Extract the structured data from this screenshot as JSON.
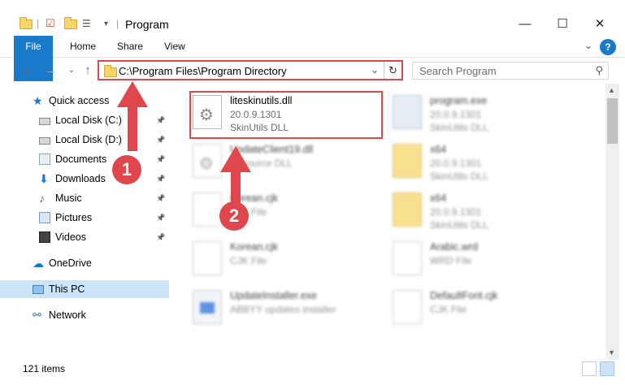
{
  "window": {
    "title": "Program",
    "minimize": "—",
    "maximize": "☐",
    "close": "✕"
  },
  "ribbon": {
    "tabs": [
      "File",
      "Home",
      "Share",
      "View"
    ],
    "help": "?"
  },
  "address": {
    "path": "C:\\Program Files\\Program Directory",
    "refresh": "↻",
    "dropdown": "⌄"
  },
  "search": {
    "placeholder": "Search Program"
  },
  "sidebar": {
    "items": [
      {
        "label": "Quick access",
        "icon": "star-icon"
      },
      {
        "label": "Local Disk (C:)",
        "icon": "drive-icon",
        "pinned": true
      },
      {
        "label": "Local Disk (D:)",
        "icon": "drive-icon",
        "pinned": true
      },
      {
        "label": "Documents",
        "icon": "documents-icon",
        "pinned": true
      },
      {
        "label": "Downloads",
        "icon": "downloads-icon",
        "pinned": true
      },
      {
        "label": "Music",
        "icon": "music-icon",
        "pinned": true
      },
      {
        "label": "Pictures",
        "icon": "pictures-icon",
        "pinned": true
      },
      {
        "label": "Videos",
        "icon": "videos-icon",
        "pinned": true
      },
      {
        "label": "OneDrive",
        "icon": "onedrive-icon"
      },
      {
        "label": "This PC",
        "icon": "this-pc-icon",
        "selected": true
      },
      {
        "label": "Network",
        "icon": "network-icon"
      }
    ]
  },
  "files": [
    {
      "name": "liteskinutils.dll",
      "meta1": "20.0.9.1301",
      "meta2": "SkinUtils DLL",
      "icon": "dll-gear-icon"
    },
    {
      "name": "program.exe",
      "meta1": "20.0.9.1301",
      "meta2": "SkinUtils DLL",
      "icon": "exe-icon"
    },
    {
      "name": "UpdateClient19.dll",
      "meta1": "Resource DLL",
      "meta2": "",
      "icon": "dll-gear-icon"
    },
    {
      "name": "x64",
      "meta1": "20.0.9.1301",
      "meta2": "SkinUtils DLL",
      "icon": "folder-icon"
    },
    {
      "name": "Korean.cjk",
      "meta1": "CJK File",
      "meta2": "",
      "icon": "document-icon"
    },
    {
      "name": "x64",
      "meta1": "20.0.9.1301",
      "meta2": "SkinUtils DLL",
      "icon": "folder-icon"
    },
    {
      "name": "Korean.cjk",
      "meta1": "CJK File",
      "meta2": "",
      "icon": "document-icon"
    },
    {
      "name": "Arabic.wrd",
      "meta1": "WRD File",
      "meta2": "",
      "icon": "document-icon"
    },
    {
      "name": "UpdateInstaller.exe",
      "meta1": "ABBYY updates installer",
      "meta2": "",
      "icon": "installer-icon"
    },
    {
      "name": "DefaultFont.cjk",
      "meta1": "CJK File",
      "meta2": "",
      "icon": "document-icon"
    }
  ],
  "status": {
    "items": "121 items"
  },
  "annotations": {
    "step1": "1",
    "step2": "2"
  },
  "colors": {
    "accent": "#1979ca",
    "highlight": "#e0474c",
    "selected": "#cce4f7"
  }
}
